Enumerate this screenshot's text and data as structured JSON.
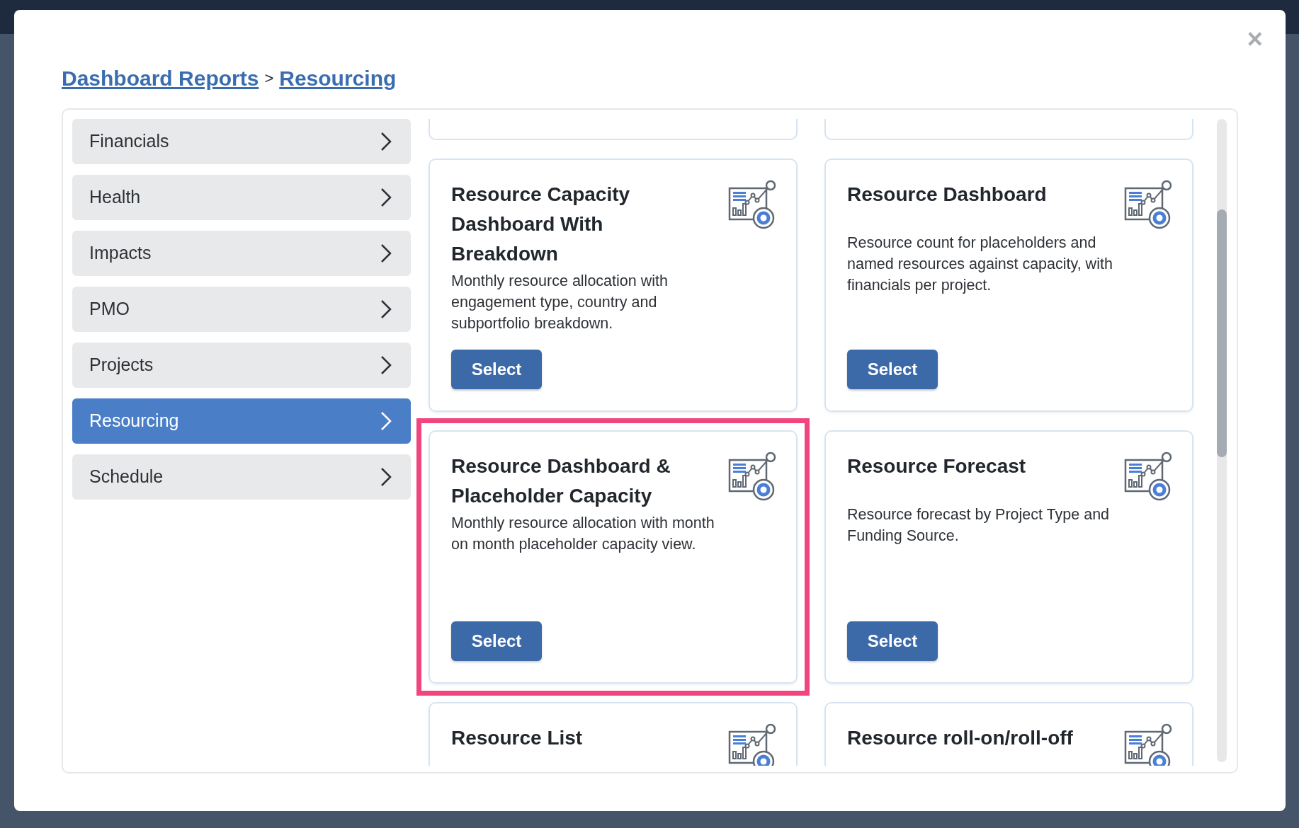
{
  "close": "×",
  "breadcrumb": [
    {
      "label": "Dashboard Reports"
    },
    {
      "label": "Resourcing"
    }
  ],
  "breadcrumb_separator": ">",
  "sidebar": {
    "items": [
      {
        "label": "Financials",
        "selected": false
      },
      {
        "label": "Health",
        "selected": false
      },
      {
        "label": "Impacts",
        "selected": false
      },
      {
        "label": "PMO",
        "selected": false
      },
      {
        "label": "Projects",
        "selected": false
      },
      {
        "label": "Resourcing",
        "selected": true
      },
      {
        "label": "Schedule",
        "selected": false
      }
    ]
  },
  "cards": [
    {
      "title": "Resource Capacity Dashboard With Breakdown",
      "description": "Monthly resource allocation with engagement type, country and subportfolio breakdown.",
      "button": "Select",
      "highlighted": false
    },
    {
      "title": "Resource Dashboard",
      "description": "Resource count for placeholders and named resources against capacity, with financials per project.",
      "button": "Select",
      "highlighted": false
    },
    {
      "title": "Resource Dashboard & Placeholder Capacity",
      "description": "Monthly resource allocation with month on month placeholder capacity view.",
      "button": "Select",
      "highlighted": true
    },
    {
      "title": "Resource Forecast",
      "description": "Resource forecast by Project Type and Funding Source.",
      "button": "Select",
      "highlighted": false
    },
    {
      "title": "Resource List",
      "highlighted": false
    },
    {
      "title": "Resource roll-on/roll-off",
      "highlighted": false
    }
  ]
}
